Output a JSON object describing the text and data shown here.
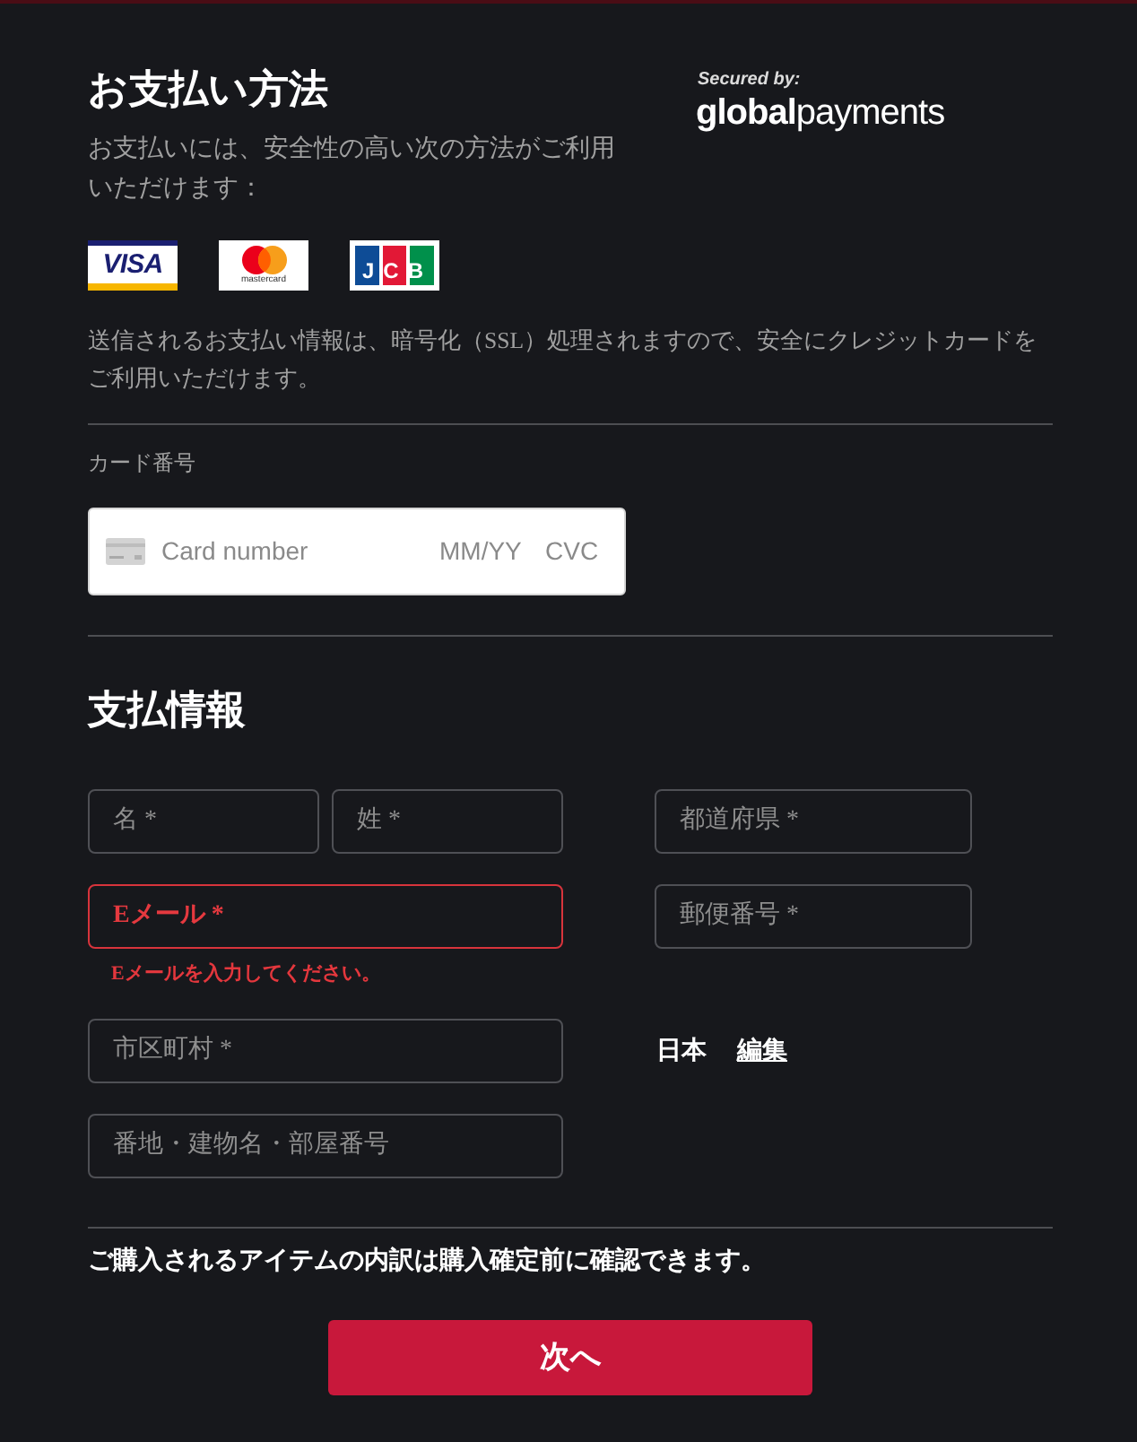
{
  "payment_method": {
    "title": "お支払い方法",
    "description": "お支払いには、安全性の高い次の方法がご利用いただけます：",
    "provider": {
      "caption": "Secured by:",
      "brand": "**global**payments"
    },
    "card_brands": [
      {
        "kind": "visa",
        "label": "VISA"
      },
      {
        "kind": "mastercard",
        "label": "mastercard"
      },
      {
        "kind": "jcb",
        "label": "JCB"
      }
    ],
    "ssl_notice": "送信されるお支払い情報は、暗号化（SSL）処理されますので、安全にクレジットカードをご利用いただけます。"
  },
  "card": {
    "label": "カード番号",
    "number_placeholder": "Card number",
    "expiry_placeholder": "MM/YY",
    "cvc_placeholder": "CVC"
  },
  "billing": {
    "title": "支払情報",
    "rows": [
      {
        "left": [
          {
            "placeholder": "名 *",
            "invalid": false
          },
          {
            "placeholder": "姓 *",
            "invalid": false
          }
        ],
        "right": {
          "kind": "field",
          "placeholder": "都道府県 *",
          "invalid": false
        }
      },
      {
        "left": [
          {
            "placeholder": "Eメール *",
            "invalid": true,
            "error": "Eメールを入力してください。"
          }
        ],
        "right": {
          "kind": "field",
          "placeholder": "郵便番号 *",
          "invalid": false
        }
      },
      {
        "left": [
          {
            "placeholder": "市区町村 *",
            "invalid": false
          }
        ],
        "right": {
          "kind": "country",
          "country": "日本",
          "edit_link": "編集"
        }
      },
      {
        "left": [
          {
            "placeholder": "番地・建物名・部屋番号",
            "invalid": false
          }
        ]
      }
    ]
  },
  "note": "ご購入されるアイテムの内訳は購入確定前に確認できます。",
  "next_button": "次へ"
}
